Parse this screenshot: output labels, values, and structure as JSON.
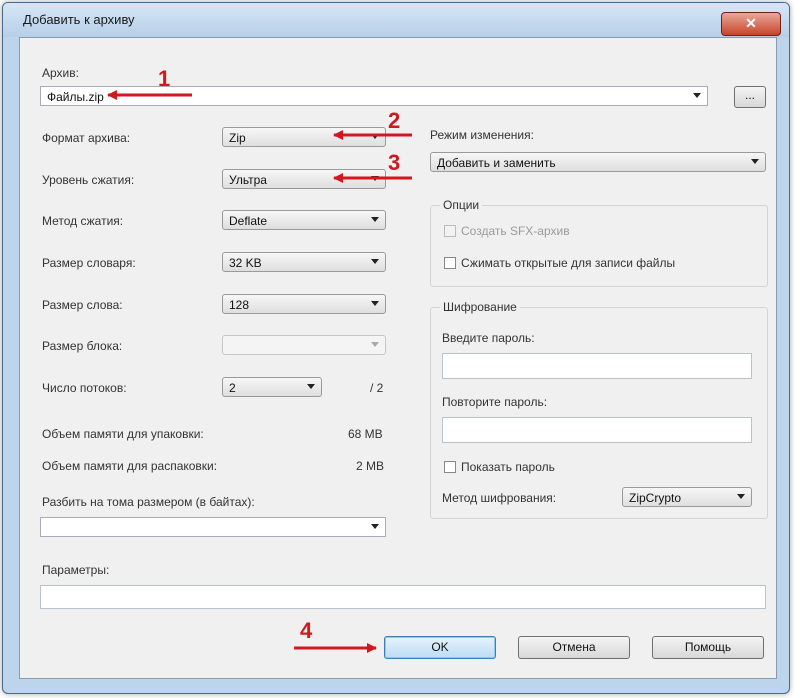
{
  "window": {
    "title": "Добавить к архиву",
    "close_glyph": "✕"
  },
  "archive": {
    "label": "Архив:",
    "value": "Файлы.zip",
    "browse_label": "..."
  },
  "left": {
    "format_label": "Формат архива:",
    "format_value": "Zip",
    "level_label": "Уровень сжатия:",
    "level_value": "Ультра",
    "method_label": "Метод сжатия:",
    "method_value": "Deflate",
    "dict_label": "Размер словаря:",
    "dict_value": "32 KB",
    "word_label": "Размер слова:",
    "word_value": "128",
    "block_label": "Размер блока:",
    "block_value": "",
    "threads_label": "Число потоков:",
    "threads_value": "2",
    "threads_total": "/ 2",
    "mem_pack_label": "Объем памяти для упаковки:",
    "mem_pack_value": "68 MB",
    "mem_unpack_label": "Объем памяти для распаковки:",
    "mem_unpack_value": "2 MB",
    "split_label": "Разбить на тома размером (в байтах):",
    "split_value": "",
    "params_label": "Параметры:",
    "params_value": ""
  },
  "right": {
    "update_label": "Режим изменения:",
    "update_value": "Добавить и заменить",
    "options_label": "Опции",
    "sfx_label": "Создать SFX-архив",
    "shared_label": "Сжимать открытые для записи файлы",
    "enc_label": "Шифрование",
    "pwd_label": "Введите пароль:",
    "pwd_value": "",
    "pwd2_label": "Повторите пароль:",
    "pwd2_value": "",
    "show_pwd_label": "Показать пароль",
    "enc_method_label": "Метод шифрования:",
    "enc_method_value": "ZipCrypto"
  },
  "buttons": {
    "ok": "OK",
    "cancel": "Отмена",
    "help": "Помощь"
  },
  "annotations": {
    "one": "1",
    "two": "2",
    "three": "3",
    "four": "4",
    "color": "#d01820"
  }
}
